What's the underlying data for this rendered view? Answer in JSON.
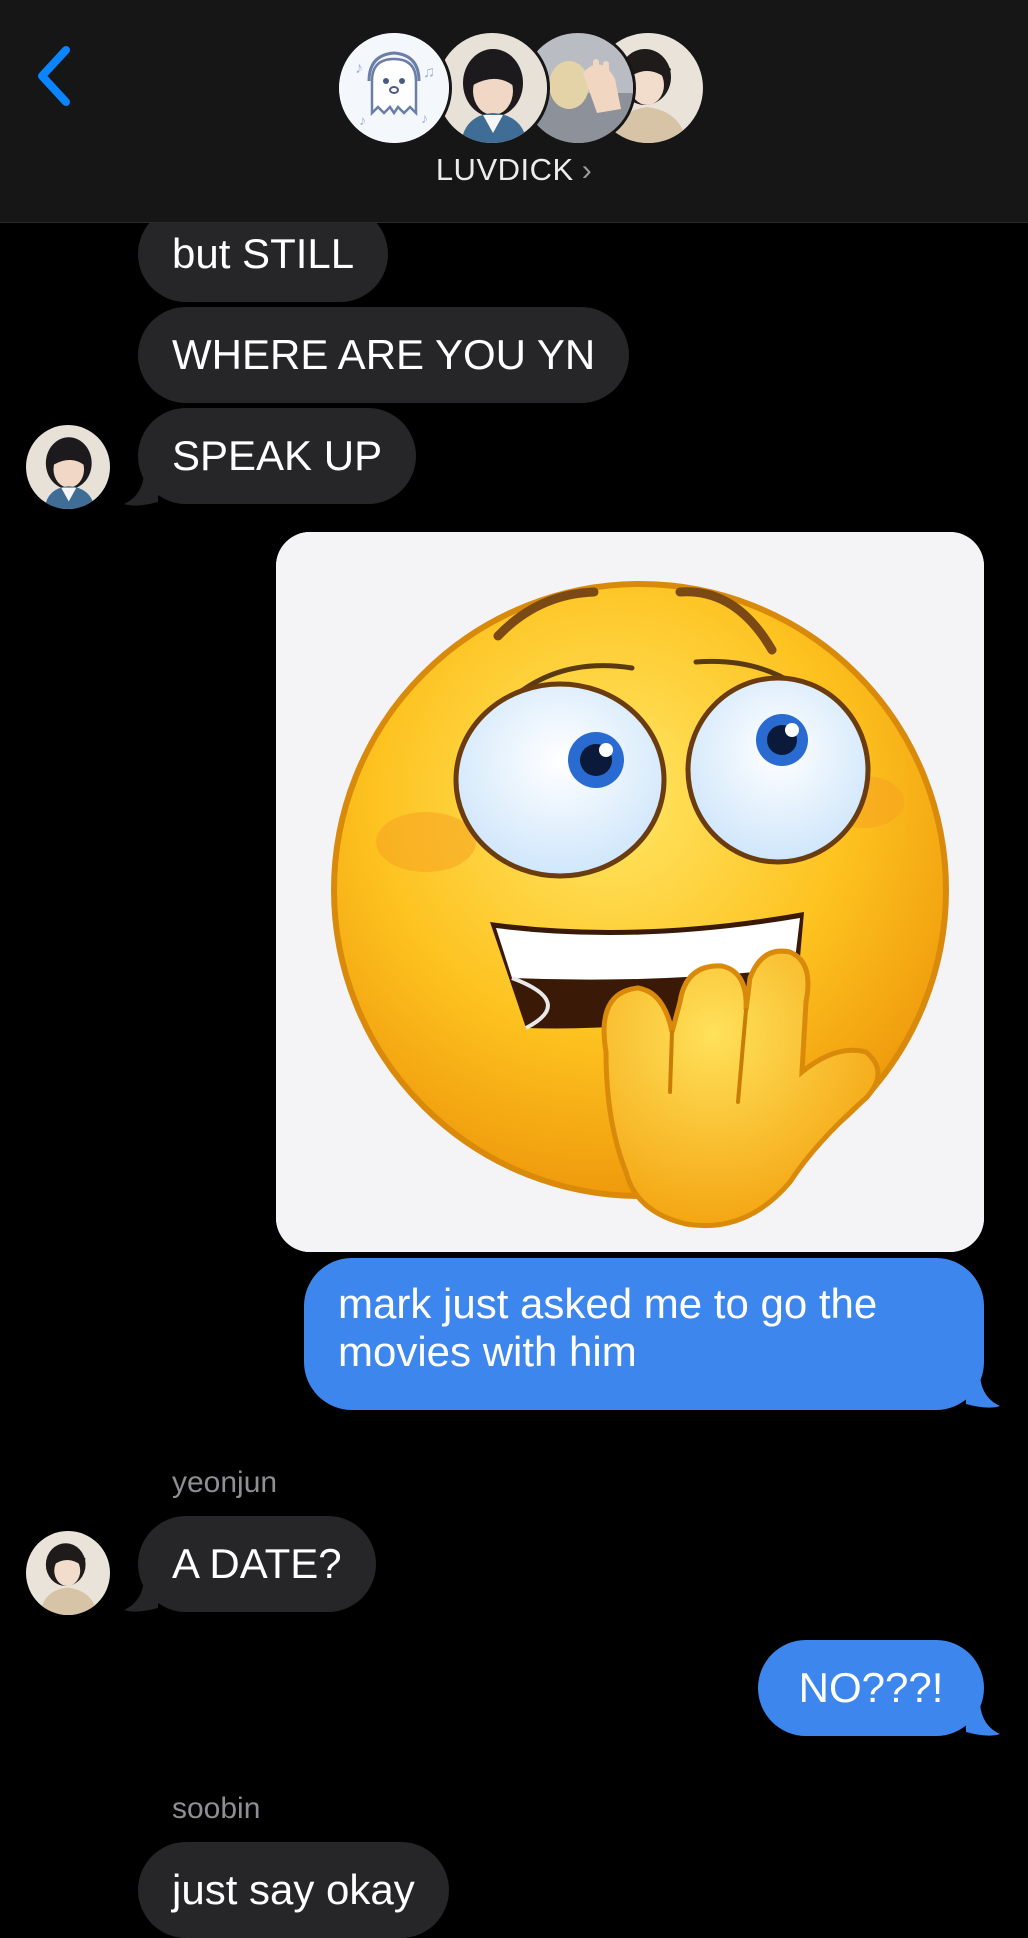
{
  "header": {
    "group_name": "LUVDICK",
    "chevron": "›",
    "back_icon": "chevron-left-icon"
  },
  "messages": [
    {
      "type": "incoming",
      "text": "but STILL"
    },
    {
      "type": "incoming",
      "text": "WHERE ARE YOU YN"
    },
    {
      "type": "incoming",
      "text": "SPEAK UP"
    },
    {
      "type": "outgoing-image",
      "image": "nervous-grin-emoji-image"
    },
    {
      "type": "outgoing",
      "text": "mark just asked me to go the movies with him"
    },
    {
      "type": "incoming",
      "sender": "yeonjun",
      "text": "A DATE?"
    },
    {
      "type": "outgoing",
      "text": "NO???!"
    },
    {
      "type": "incoming",
      "sender": "soobin",
      "text": "just say okay"
    }
  ],
  "colors": {
    "outgoing_bubble": "#3d86ed",
    "incoming_bubble": "#262628",
    "background": "#000000",
    "accent": "#0a84ff"
  }
}
